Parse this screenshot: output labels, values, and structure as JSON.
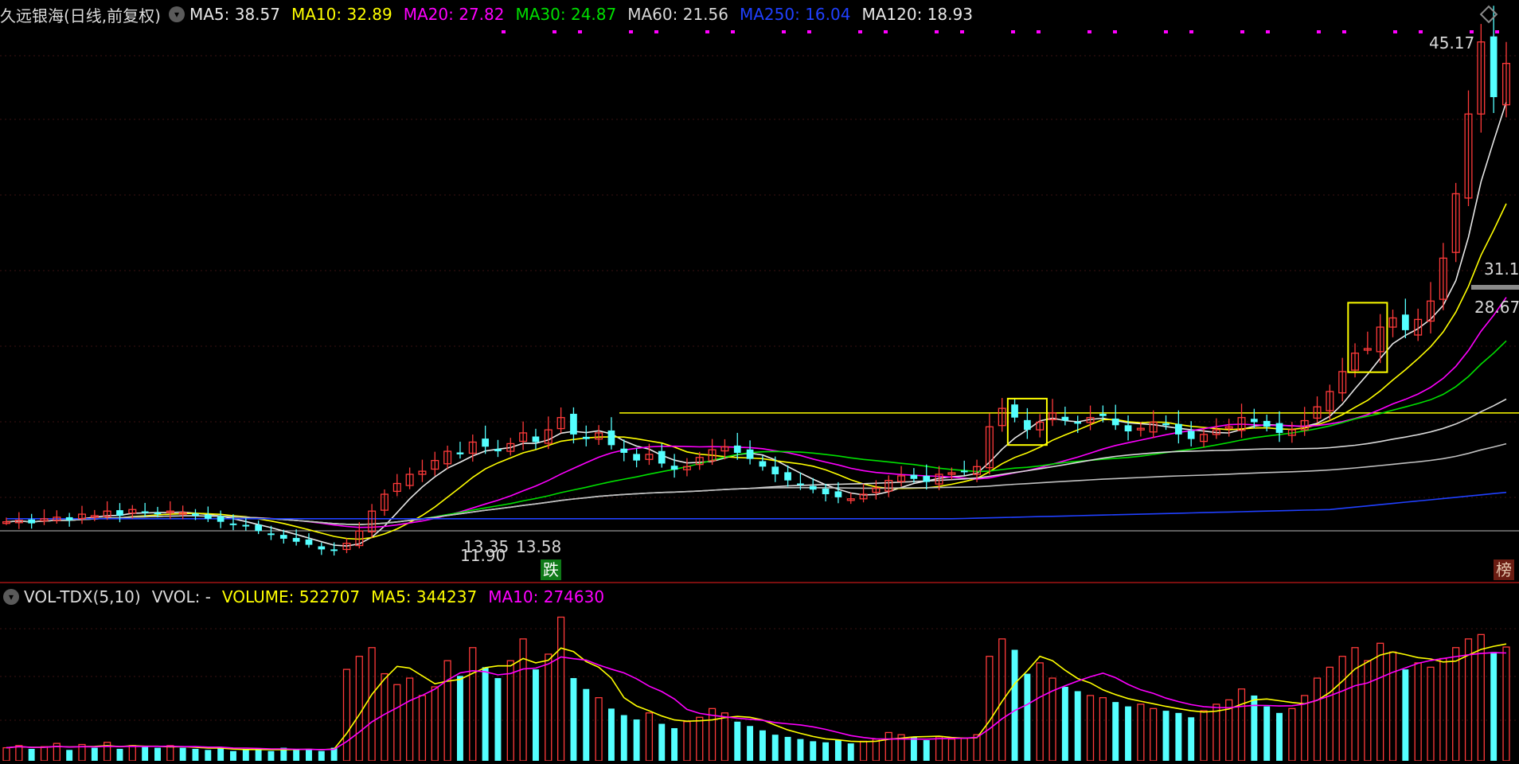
{
  "header": {
    "title": "久远银海(日线,前复权)",
    "ma": [
      {
        "label": "MA5: 38.57",
        "color": "#e8e8e8"
      },
      {
        "label": "MA10: 32.89",
        "color": "#ffff00"
      },
      {
        "label": "MA20: 27.82",
        "color": "#ff00ff"
      },
      {
        "label": "MA30: 24.87",
        "color": "#00e000"
      },
      {
        "label": "MA60: 21.56",
        "color": "#d8d8d8"
      },
      {
        "label": "MA250: 16.04",
        "color": "#2040ff"
      },
      {
        "label": "MA120: 18.93",
        "color": "#e8e8e8"
      }
    ]
  },
  "price_labels": {
    "high": "45.17",
    "low": "11.90",
    "low_near": "13.35",
    "low_near2": "13.58",
    "mid1": "31.1",
    "mid2": "28.67"
  },
  "tags": {
    "down": "跌",
    "right": "榜"
  },
  "vol_header": {
    "name": "VOL-TDX(5,10)",
    "vvol": "VVOL: -",
    "volume": "VOLUME: 522707",
    "ma5": "MA5: 344237",
    "ma10": "MA10: 274630"
  },
  "colors": {
    "up": "#ff3a3a",
    "down": "#54ffff",
    "bg": "#000000"
  },
  "chart_data": {
    "type": "candlestick",
    "title": "久远银海(日线,前复权)",
    "price_high": 45.17,
    "price_low": 11.9,
    "reference_line_price": 20.9,
    "close": [
      13.8,
      13.9,
      13.7,
      14.0,
      14.1,
      13.9,
      14.3,
      14.2,
      14.5,
      14.2,
      14.6,
      14.4,
      14.3,
      14.5,
      14.4,
      14.2,
      14.0,
      13.8,
      13.6,
      13.5,
      13.2,
      13.0,
      12.7,
      12.5,
      12.3,
      12.0,
      11.9,
      12.4,
      13.2,
      14.5,
      15.6,
      16.3,
      16.9,
      17.1,
      17.8,
      18.4,
      18.2,
      19.0,
      18.7,
      18.4,
      18.9,
      19.6,
      19.0,
      19.8,
      20.6,
      19.5,
      19.2,
      19.6,
      18.8,
      18.3,
      17.8,
      18.2,
      17.6,
      17.2,
      17.4,
      18.0,
      18.5,
      18.7,
      18.3,
      17.9,
      17.4,
      16.9,
      16.5,
      16.2,
      15.9,
      15.6,
      15.4,
      15.3,
      15.6,
      16.0,
      16.5,
      16.8,
      16.6,
      16.4,
      16.9,
      17.0,
      17.1,
      17.4,
      20.0,
      21.2,
      20.6,
      19.8,
      20.3,
      20.9,
      20.4,
      20.2,
      20.6,
      20.7,
      20.1,
      19.7,
      19.9,
      20.3,
      20.1,
      19.5,
      19.2,
      19.5,
      19.8,
      20.0,
      20.6,
      20.3,
      20.0,
      19.6,
      19.8,
      20.4,
      21.3,
      22.3,
      23.6,
      24.8,
      25.1,
      26.5,
      27.1,
      26.3,
      27.0,
      28.2,
      31.0,
      35.2,
      40.4,
      45.1,
      41.5,
      43.7
    ],
    "volume": [
      60,
      70,
      55,
      65,
      80,
      50,
      75,
      60,
      85,
      55,
      70,
      65,
      60,
      70,
      60,
      55,
      50,
      60,
      45,
      50,
      55,
      45,
      60,
      50,
      55,
      45,
      60,
      420,
      480,
      520,
      400,
      350,
      380,
      300,
      340,
      460,
      390,
      520,
      430,
      380,
      460,
      560,
      420,
      490,
      660,
      380,
      330,
      290,
      240,
      210,
      190,
      220,
      170,
      150,
      180,
      200,
      240,
      220,
      180,
      160,
      140,
      120,
      110,
      100,
      90,
      85,
      95,
      80,
      90,
      100,
      130,
      120,
      110,
      95,
      110,
      100,
      105,
      120,
      480,
      560,
      510,
      400,
      450,
      380,
      340,
      320,
      300,
      290,
      270,
      250,
      260,
      240,
      230,
      220,
      200,
      230,
      260,
      280,
      330,
      300,
      250,
      220,
      240,
      300,
      380,
      430,
      480,
      520,
      460,
      540,
      500,
      420,
      450,
      430,
      470,
      520,
      560,
      580,
      500,
      522.7
    ],
    "series_ma": [
      "MA5",
      "MA10",
      "MA20",
      "MA30",
      "MA60",
      "MA250",
      "MA120"
    ]
  }
}
